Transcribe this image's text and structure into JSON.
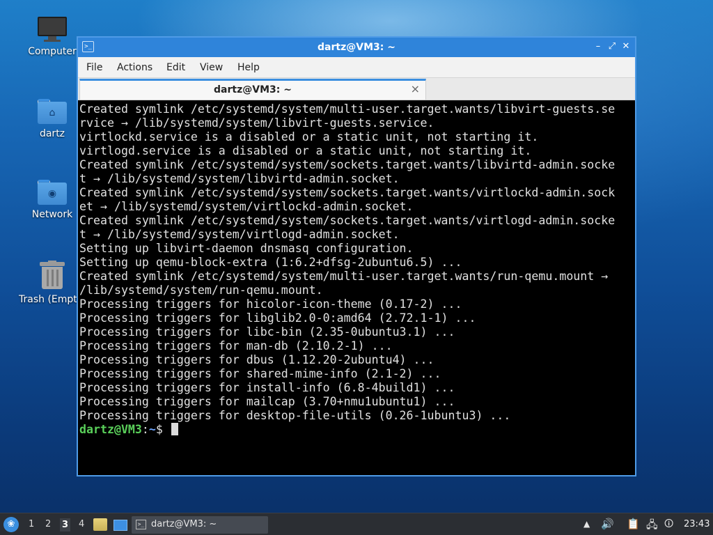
{
  "desktop": {
    "icons": [
      {
        "label": "Computer",
        "icon": "computer-icon"
      },
      {
        "label": "dartz",
        "icon": "home-folder-icon"
      },
      {
        "label": "Network",
        "icon": "network-folder-icon"
      },
      {
        "label": "Trash (Empty)",
        "icon": "trash-icon"
      }
    ]
  },
  "window": {
    "title": "dartz@VM3: ~",
    "app_icon": ">_",
    "buttons": {
      "minimize": "–",
      "maximize": "⤢",
      "close": "✕"
    },
    "menu": [
      "File",
      "Actions",
      "Edit",
      "View",
      "Help"
    ],
    "tab": {
      "label": "dartz@VM3: ~",
      "close": "×"
    }
  },
  "terminal": {
    "lines": [
      "Created symlink /etc/systemd/system/multi-user.target.wants/libvirt-guests.se",
      "rvice → /lib/systemd/system/libvirt-guests.service.",
      "virtlockd.service is a disabled or a static unit, not starting it.",
      "virtlogd.service is a disabled or a static unit, not starting it.",
      "Created symlink /etc/systemd/system/sockets.target.wants/libvirtd-admin.socke",
      "t → /lib/systemd/system/libvirtd-admin.socket.",
      "Created symlink /etc/systemd/system/sockets.target.wants/virtlockd-admin.sock",
      "et → /lib/systemd/system/virtlockd-admin.socket.",
      "Created symlink /etc/systemd/system/sockets.target.wants/virtlogd-admin.socke",
      "t → /lib/systemd/system/virtlogd-admin.socket.",
      "Setting up libvirt-daemon dnsmasq configuration.",
      "Setting up qemu-block-extra (1:6.2+dfsg-2ubuntu6.5) ...",
      "Created symlink /etc/systemd/system/multi-user.target.wants/run-qemu.mount →",
      "/lib/systemd/system/run-qemu.mount.",
      "Processing triggers for hicolor-icon-theme (0.17-2) ...",
      "Processing triggers for libglib2.0-0:amd64 (2.72.1-1) ...",
      "Processing triggers for libc-bin (2.35-0ubuntu3.1) ...",
      "Processing triggers for man-db (2.10.2-1) ...",
      "Processing triggers for dbus (1.12.20-2ubuntu4) ...",
      "Processing triggers for shared-mime-info (2.1-2) ...",
      "Processing triggers for install-info (6.8-4build1) ...",
      "Processing triggers for mailcap (3.70+nmu1ubuntu1) ...",
      "Processing triggers for desktop-file-utils (0.26-1ubuntu3) ..."
    ],
    "prompt": {
      "user_host": "dartz@VM3",
      "sep": ":",
      "path": "~",
      "symbol": "$ "
    }
  },
  "taskbar": {
    "start_icon": "start-menu-icon",
    "workspaces": [
      "1",
      "2",
      "3",
      "4"
    ],
    "active_workspace": "3",
    "task": {
      "label": "dartz@VM3: ~",
      "icon": ">_"
    },
    "tray": {
      "update_icon": "▲",
      "volume_icon": "🔊",
      "clipboard_icon": "📋",
      "network_icon": "🖧",
      "notify_icon": "🛈"
    },
    "clock": "23:43"
  },
  "colors": {
    "accent": "#3b8fe0",
    "prompt_user": "#5ad05a",
    "prompt_path": "#6ea5ff",
    "terminal_bg": "#000000",
    "taskbar_bg": "#2b2e33"
  }
}
